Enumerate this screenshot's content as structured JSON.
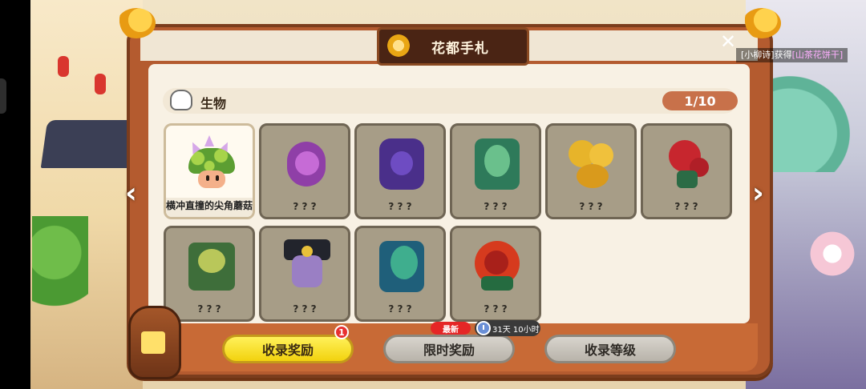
{
  "title": "花都手札",
  "notification": {
    "prefix": "[小柳诗]获得",
    "item": "[山茶花饼干]"
  },
  "category": {
    "label": "生物",
    "progress": "1/10"
  },
  "cards": [
    {
      "name": "横冲直撞的尖角蘑菇",
      "unlocked": true,
      "art": "mushroom-icon"
    },
    {
      "name": "? ? ?",
      "unlocked": false,
      "art": "purple-serpent-icon"
    },
    {
      "name": "? ? ?",
      "unlocked": false,
      "art": "purple-beetle-icon"
    },
    {
      "name": "? ? ?",
      "unlocked": false,
      "art": "green-vine-icon"
    },
    {
      "name": "? ? ?",
      "unlocked": false,
      "art": "yellow-flower-icon"
    },
    {
      "name": "? ? ?",
      "unlocked": false,
      "art": "red-rose-icon"
    },
    {
      "name": "? ? ?",
      "unlocked": false,
      "art": "green-spiky-icon"
    },
    {
      "name": "? ? ?",
      "unlocked": false,
      "art": "masked-figure-icon"
    },
    {
      "name": "? ? ?",
      "unlocked": false,
      "art": "teal-vine-icon"
    },
    {
      "name": "? ? ?",
      "unlocked": false,
      "art": "red-flower-icon"
    }
  ],
  "buttons": {
    "collection_reward": "收录奖励",
    "collection_badge": "1",
    "limited_reward": "限时奖励",
    "new_tag": "最新",
    "timer": "31天 10小时",
    "collection_level": "收录等级"
  },
  "colors": {
    "frame": "#b45b2f",
    "title_plaque": "#4a2414",
    "progress_pill": "#c8714a",
    "primary_button": "#f2d20e",
    "secondary_button": "#b8b3aa"
  }
}
